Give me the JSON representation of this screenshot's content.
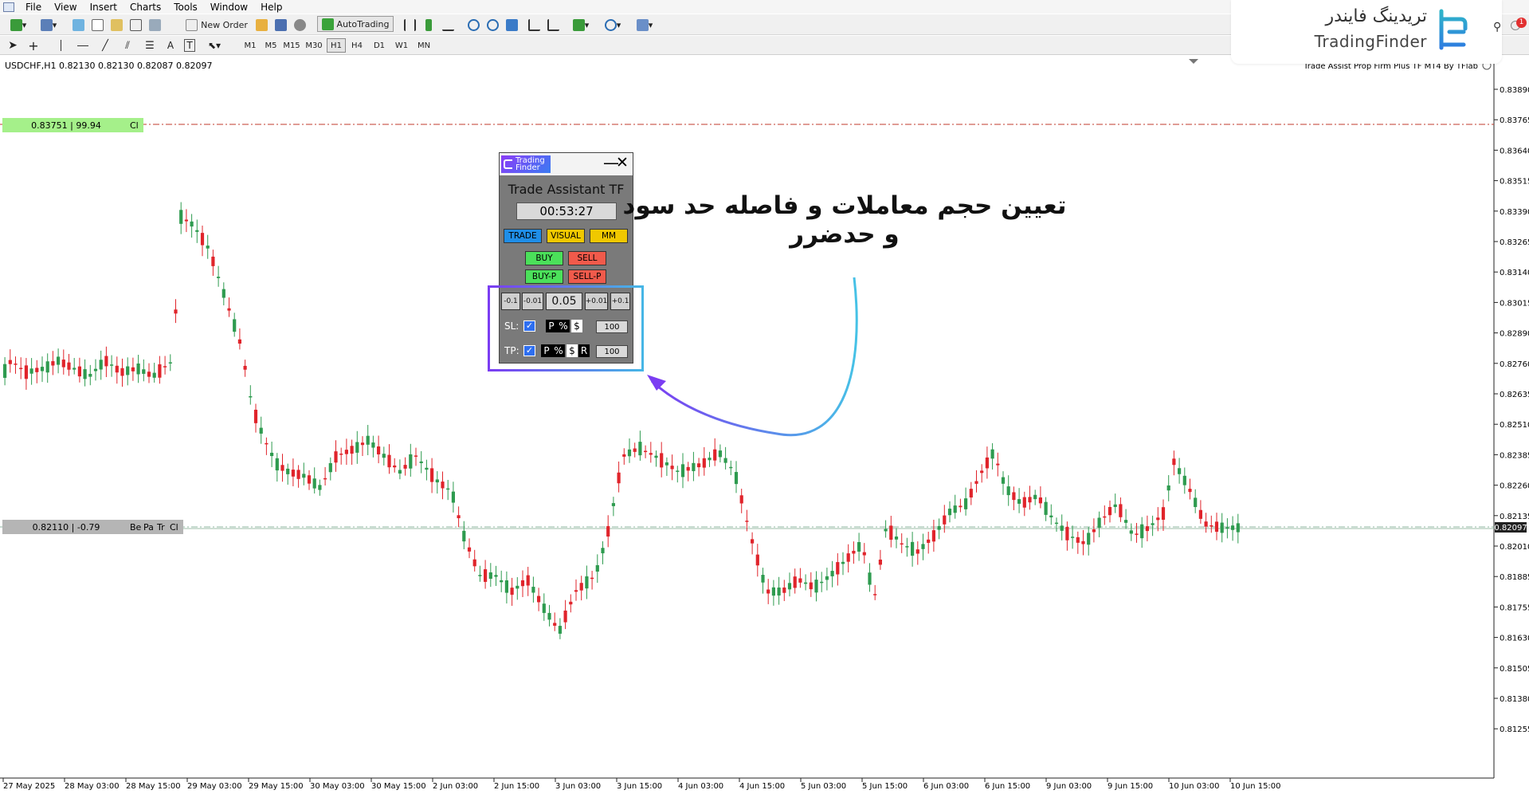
{
  "menu": [
    "File",
    "View",
    "Insert",
    "Charts",
    "Tools",
    "Window",
    "Help"
  ],
  "toolbar": {
    "new_order": "New Order",
    "autotrading": "AutoTrading"
  },
  "timeframes": [
    "M1",
    "M5",
    "M15",
    "M30",
    "H1",
    "H4",
    "D1",
    "W1",
    "MN"
  ],
  "logo": {
    "text_fa": "تریدینگ فایندر",
    "text_en": "TradingFinder"
  },
  "chart": {
    "symbol_info": "USDCHF,H1  0.82130 0.82130 0.82087 0.82097",
    "indicator_name": "Trade Assist Prop Firm Plus TF MT4 By TFlab",
    "upper_line_label": "0.83751 | 99.94",
    "upper_line_tag": "Cl",
    "current_line_label": "0.82110 | -0.79",
    "current_line_tags": [
      "Be",
      "Pa",
      "Tr",
      "Cl"
    ],
    "current_price": "0.82097",
    "price_ticks": [
      "0.83890",
      "0.83765",
      "0.83640",
      "0.83515",
      "0.83390",
      "0.83265",
      "0.83140",
      "0.83015",
      "0.82890",
      "0.82760",
      "0.82635",
      "0.82510",
      "0.82385",
      "0.82260",
      "0.82135",
      "0.82010",
      "0.81885",
      "0.81755",
      "0.81630",
      "0.81505",
      "0.81380",
      "0.81255"
    ],
    "time_ticks": [
      "27 May 2025",
      "28 May 03:00",
      "28 May 15:00",
      "29 May 03:00",
      "29 May 15:00",
      "30 May 03:00",
      "30 May 15:00",
      "2 Jun 03:00",
      "2 Jun 15:00",
      "3 Jun 03:00",
      "3 Jun 15:00",
      "4 Jun 03:00",
      "4 Jun 15:00",
      "5 Jun 03:00",
      "5 Jun 15:00",
      "6 Jun 03:00",
      "6 Jun 15:00",
      "9 Jun 03:00",
      "9 Jun 15:00",
      "10 Jun 03:00",
      "10 Jun 15:00"
    ],
    "colors": {
      "bull": "#2e9b4f",
      "bear": "#e0242b",
      "upper_line": "#c0392b",
      "current_line": "#8fb7a0"
    },
    "badge_count": "1"
  },
  "panel": {
    "logo_line1": "Trading",
    "logo_line2": "Finder",
    "minimize": "—",
    "close": "✕",
    "title": "Trade Assistant TF",
    "timer": "00:53:27",
    "tabs": [
      "TRADE",
      "VISUAL",
      "MM"
    ],
    "buy": "BUY",
    "sell": "SELL",
    "buy_p": "BUY-P",
    "sell_p": "SELL-P",
    "lot_minus_big": "-0.1",
    "lot_minus_small": "-0.01",
    "lot_value": "0.05",
    "lot_plus_small": "+0.01",
    "lot_plus_big": "+0.1",
    "sl_label": "SL:",
    "tp_label": "TP:",
    "check": "✓",
    "sl_modes": [
      "P",
      "%",
      "$"
    ],
    "tp_modes": [
      "P",
      "%",
      "$",
      "R"
    ],
    "sl_value": "100",
    "tp_value": "100"
  },
  "annotation": {
    "line1": "تعیین حجم معاملات و فاصله حد سود",
    "line2": "و حدضرر"
  }
}
